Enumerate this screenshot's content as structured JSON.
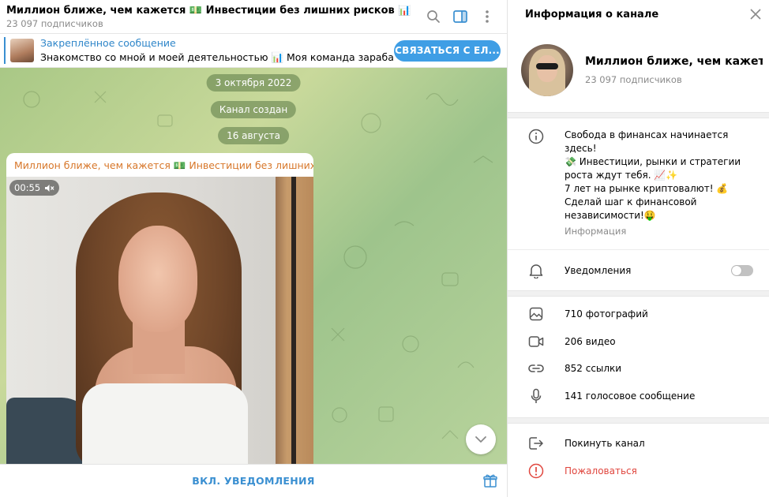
{
  "chat": {
    "title": "Миллион ближе, чем кажется 💵 Инвестиции без лишних рисков 📊",
    "subscribers": "23 097 подписчиков",
    "pinned": {
      "title": "Закреплённое сообщение",
      "text": "Знакомство со мной и моей деятельностью 📊  Моя команда зарабатывает...",
      "button": "СВЯЗАТЬСЯ С ЕЛ..."
    },
    "dates": [
      "3 октября 2022",
      "Канал создан",
      "16 августа"
    ],
    "message": {
      "author": "Миллион ближе, чем кажется 💵 Инвестиции без лишних р...",
      "duration": "00:55"
    },
    "bottom_action": "ВКЛ. УВЕДОМЛЕНИЯ"
  },
  "info": {
    "header": "Информация о канале",
    "name": "Миллион ближе, чем кажет...",
    "subscribers": "23 097 подписчиков",
    "description": [
      "Свобода в финансах начинается здесь!",
      "💸 Инвестиции, рынки и стратегии",
      "роста ждут тебя. 📈✨",
      "7 лет на рынке криптовалют! 💰",
      "Сделай шаг к финансовой",
      "независимости!🤑"
    ],
    "description_caption": "Информация",
    "notifications_label": "Уведомления",
    "notifications_on": false,
    "media": [
      {
        "icon": "photo-icon",
        "label": "710 фотографий"
      },
      {
        "icon": "video-icon",
        "label": "206 видео"
      },
      {
        "icon": "link-icon",
        "label": "852 ссылки"
      },
      {
        "icon": "microphone-icon",
        "label": "141 голосовое сообщение"
      }
    ],
    "leave": "Покинуть канал",
    "report": "Пожаловаться"
  },
  "colors": {
    "accent": "#3a8fd1",
    "author": "#d7772a",
    "danger": "#e0463e"
  }
}
